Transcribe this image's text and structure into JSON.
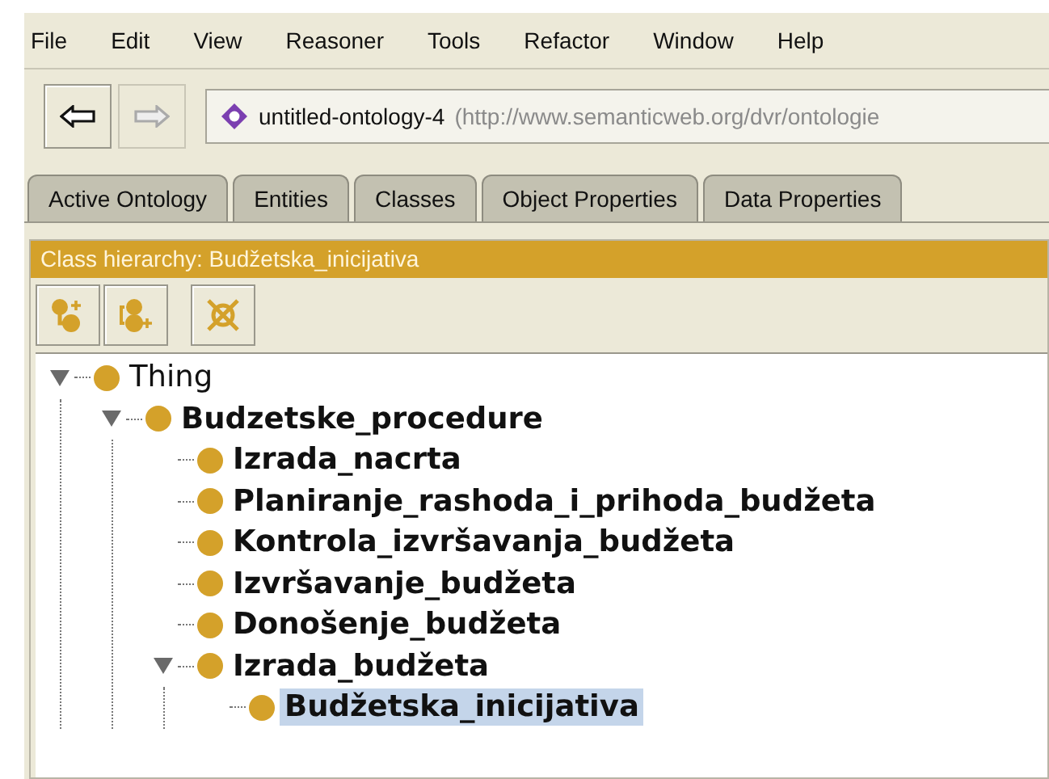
{
  "menu": [
    "File",
    "Edit",
    "View",
    "Reasoner",
    "Tools",
    "Refactor",
    "Window",
    "Help"
  ],
  "navigation": {
    "back_enabled": true,
    "forward_enabled": false
  },
  "ontology_field": {
    "name": "untitled-ontology-4",
    "uri": "(http://www.semanticweb.org/dvr/ontologie"
  },
  "tabs": [
    {
      "label": "Active Ontology",
      "selected": false
    },
    {
      "label": "Entities",
      "selected": false
    },
    {
      "label": "Classes",
      "selected": false
    },
    {
      "label": "Object Properties",
      "selected": false
    },
    {
      "label": "Data Properties",
      "selected": false
    }
  ],
  "panel": {
    "title": "Class hierarchy: Budžetska_inicijativa",
    "tools": [
      {
        "kind": "add-subclass"
      },
      {
        "kind": "add-sibling"
      },
      {
        "kind": "delete"
      }
    ]
  },
  "tree": [
    {
      "label": "Thing",
      "bold": false,
      "selected": false,
      "expanded": true,
      "children": [
        {
          "label": "Budzetske_procedure",
          "bold": true,
          "selected": false,
          "expanded": true,
          "children": [
            {
              "label": "Izrada_nacrta",
              "bold": true,
              "selected": false
            },
            {
              "label": "Planiranje_rashoda_i_prihoda_budžeta",
              "bold": true,
              "selected": false
            },
            {
              "label": "Kontrola_izvršavanja_budžeta",
              "bold": true,
              "selected": false
            },
            {
              "label": "Izvršavanje_budžeta",
              "bold": true,
              "selected": false
            },
            {
              "label": "Donošenje_budžeta",
              "bold": true,
              "selected": false
            },
            {
              "label": "Izrada_budžeta",
              "bold": true,
              "selected": false,
              "expanded": true,
              "children": [
                {
                  "label": "Budžetska_inicijativa",
                  "bold": true,
                  "selected": true
                }
              ]
            }
          ]
        }
      ]
    }
  ]
}
